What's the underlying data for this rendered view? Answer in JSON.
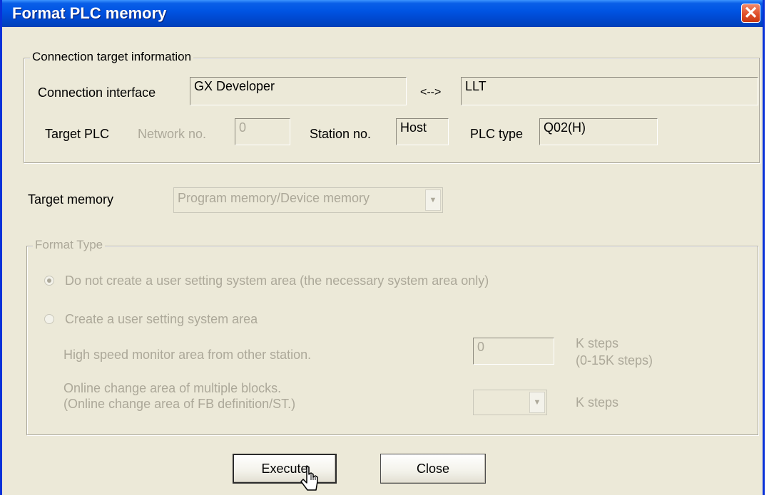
{
  "window": {
    "title": "Format PLC memory",
    "close_glyph": "✕"
  },
  "connection": {
    "legend": "Connection target information",
    "interface_label": "Connection interface",
    "interface_value": "GX Developer",
    "arrow": "<-->",
    "link_value": "LLT",
    "target_plc_label": "Target PLC",
    "network_label": "Network no.",
    "network_value": "0",
    "station_label": "Station no.",
    "station_value": "Host",
    "plc_type_label": "PLC type",
    "plc_type_value": "Q02(H)"
  },
  "target_memory": {
    "label": "Target memory",
    "selected": "Program memory/Device memory"
  },
  "format_type": {
    "legend": "Format Type",
    "option1": "Do not create a user setting system area (the necessary system area only)",
    "option1_selected": true,
    "option2": "Create a user setting system area",
    "option2_selected": false,
    "high_speed_label": "High speed monitor area from other station.",
    "high_speed_value": "0",
    "high_speed_unit_line1": "K steps",
    "high_speed_unit_line2": "(0-15K steps)",
    "online_change_line1": "Online change area of multiple blocks.",
    "online_change_line2": "(Online change area of FB definition/ST.)",
    "online_change_value": "",
    "online_change_unit": "K steps"
  },
  "buttons": {
    "execute": "Execute",
    "close": "Close"
  },
  "icons": {
    "close": "close-icon",
    "dropdown": "chevron-down-icon",
    "cursor": "mouse-pointer-icon"
  },
  "colors": {
    "title_bar": "#0054e3",
    "dialog_bg": "#ece9d8",
    "close_button": "#e0502c",
    "disabled_text": "#aca899"
  }
}
